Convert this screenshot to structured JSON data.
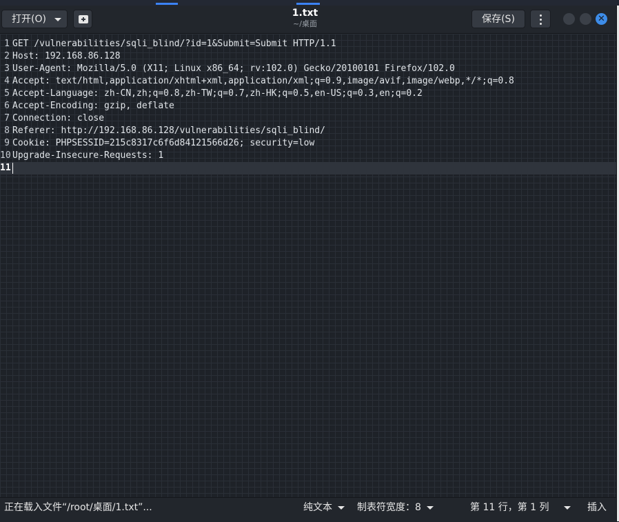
{
  "header": {
    "open_label": "打开(O)",
    "title": "1.txt",
    "subtitle": "~/桌面",
    "save_label": "保存(S)",
    "close_glyph": "✕"
  },
  "editor": {
    "lines": [
      {
        "num": "1",
        "text": "GET /vulnerabilities/sqli_blind/?id=1&Submit=Submit HTTP/1.1"
      },
      {
        "num": "2",
        "text": "Host: 192.168.86.128"
      },
      {
        "num": "3",
        "text": "User-Agent: Mozilla/5.0 (X11; Linux x86_64; rv:102.0) Gecko/20100101 Firefox/102.0"
      },
      {
        "num": "4",
        "text": "Accept: text/html,application/xhtml+xml,application/xml;q=0.9,image/avif,image/webp,*/*;q=0.8"
      },
      {
        "num": "5",
        "text": "Accept-Language: zh-CN,zh;q=0.8,zh-TW;q=0.7,zh-HK;q=0.5,en-US;q=0.3,en;q=0.2"
      },
      {
        "num": "6",
        "text": "Accept-Encoding: gzip, deflate"
      },
      {
        "num": "7",
        "text": "Connection: close"
      },
      {
        "num": "8",
        "text": "Referer: http://192.168.86.128/vulnerabilities/sqli_blind/"
      },
      {
        "num": "9",
        "text": "Cookie: PHPSESSID=215c8317c6f6d84121566d26; security=low"
      },
      {
        "num": "10",
        "text": "Upgrade-Insecure-Requests: 1"
      },
      {
        "num": "11",
        "text": ""
      }
    ],
    "current_line": 11
  },
  "statusbar": {
    "message": "正在载入文件“/root/桌面/1.txt”...",
    "syntax": "纯文本",
    "tab_width": "制表符宽度：8",
    "position": "第 11 行，第 1 列",
    "mode": "插入"
  }
}
